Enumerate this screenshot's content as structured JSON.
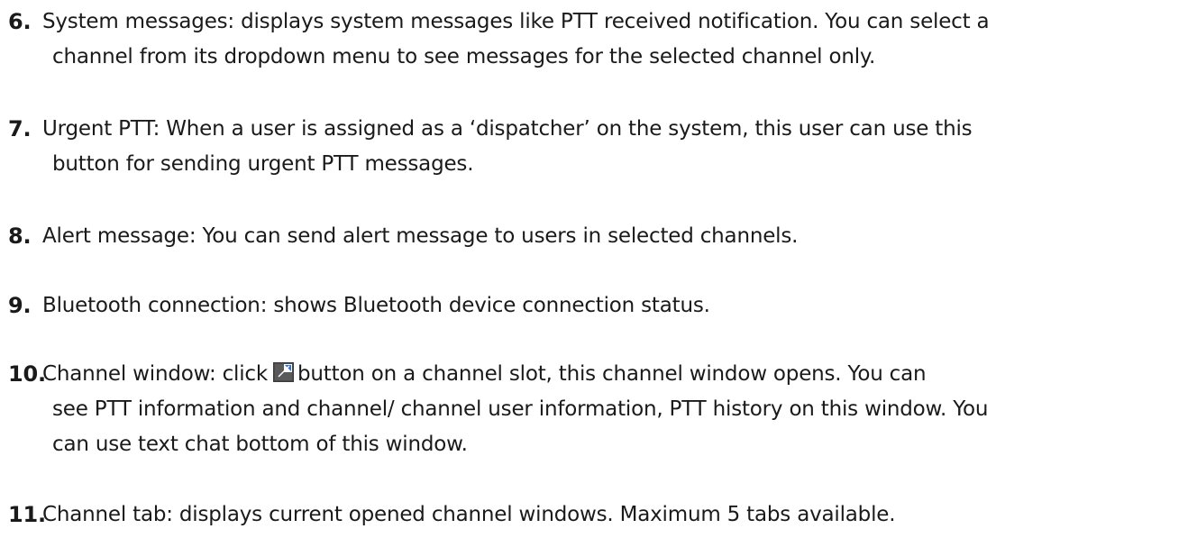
{
  "items": [
    {
      "number": "6.",
      "lines": [
        "System messages: displays system messages like PTT received notification. You can select a",
        "channel from its dropdown menu to see messages for the selected channel only."
      ]
    },
    {
      "number": "7.",
      "lines": [
        "Urgent PTT: When a user is assigned as a ‘dispatcher’ on the system, this user can use this",
        "button for sending urgent PTT messages."
      ]
    },
    {
      "number": "8.",
      "lines": [
        "Alert message: You can send alert message to users in selected channels."
      ]
    },
    {
      "number": "9.",
      "lines": [
        "Bluetooth connection: shows Bluetooth device connection status."
      ]
    },
    {
      "number": "10.",
      "line1_before_icon": "Channel window: click",
      "icon": "expand-window-icon",
      "line1_after_icon": "button on a channel slot, this channel window opens. You can",
      "lines_rest": [
        "see PTT information and channel/ channel user information, PTT history on this window. You",
        "can use text chat bottom of this window."
      ]
    },
    {
      "number": "11.",
      "lines": [
        "Channel tab: displays current opened channel windows. Maximum 5 tabs available."
      ]
    }
  ]
}
